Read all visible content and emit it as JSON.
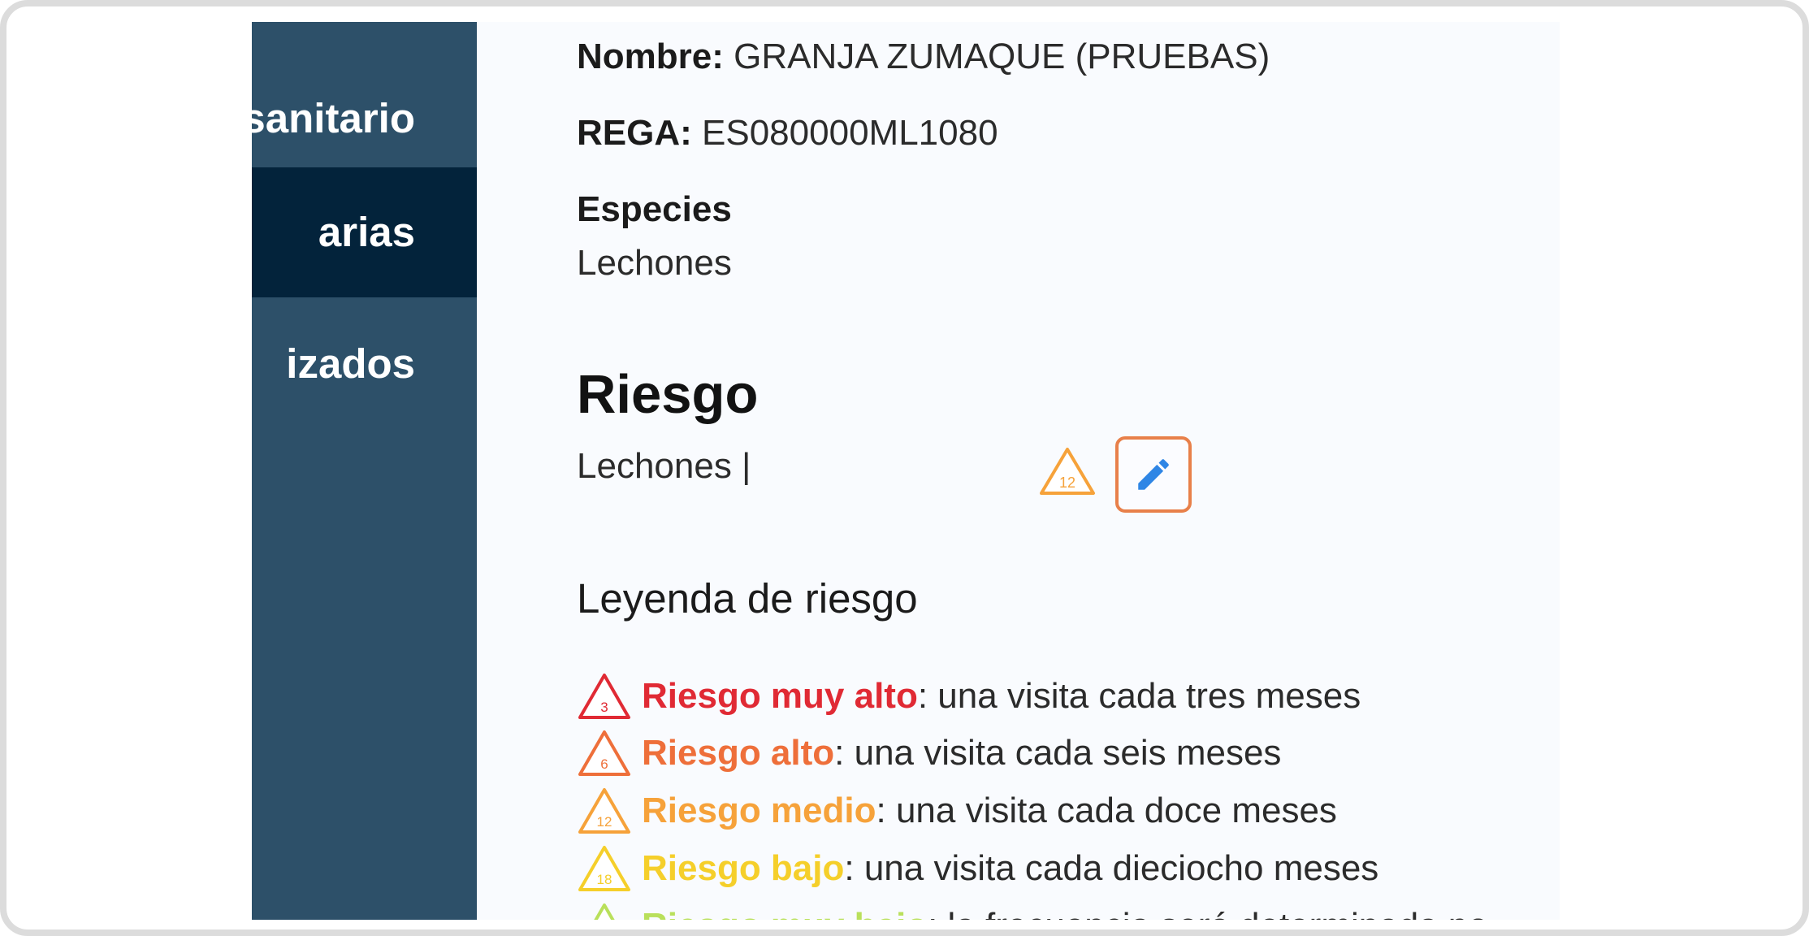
{
  "sidebar": {
    "items": [
      {
        "label": "sanitario",
        "active": false
      },
      {
        "label": "arias",
        "active": true
      },
      {
        "label": "izados",
        "active": false
      }
    ]
  },
  "farm": {
    "nombre_label": "Nombre:",
    "nombre_value": "GRANJA ZUMAQUE (PRUEBAS)",
    "rega_label": "REGA:",
    "rega_value": "ES080000ML1080",
    "especies_label": "Especies",
    "especies_value": "Lechones"
  },
  "riesgo": {
    "title": "Riesgo",
    "row_label": "Lechones |",
    "badge_number": "12",
    "badge_color": "#f6a23a",
    "edit_icon": "pencil-icon"
  },
  "leyenda": {
    "title": "Leyenda de riesgo",
    "items": [
      {
        "number": "3",
        "level": "Riesgo muy alto",
        "desc": ": una visita cada tres meses",
        "color": "#e02a34"
      },
      {
        "number": "6",
        "level": "Riesgo alto",
        "desc": ": una visita cada seis meses",
        "color": "#ee6f3a"
      },
      {
        "number": "12",
        "level": "Riesgo medio",
        "desc": ": una visita cada doce meses",
        "color": "#f6a23a"
      },
      {
        "number": "18",
        "level": "Riesgo bajo",
        "desc": ": una visita cada dieciocho meses",
        "color": "#f5cf2a"
      },
      {
        "number": "",
        "level": "Riesgo muy bajo",
        "desc": ": la frecuencia será determinada po",
        "color": "#b9e05b"
      }
    ]
  }
}
